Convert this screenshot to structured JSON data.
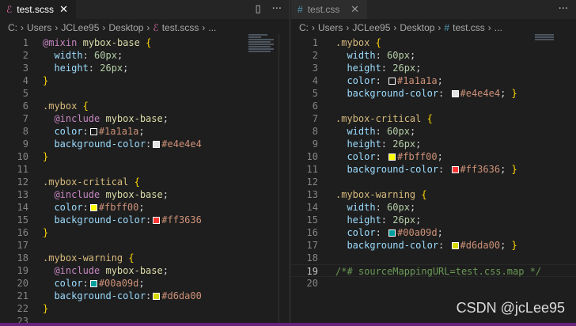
{
  "left": {
    "tab": {
      "label": "test.scss",
      "icon": "sass-icon",
      "close": "✕"
    },
    "breadcrumb": [
      "C:",
      "Users",
      "JCLee95",
      "Desktop",
      "test.scss",
      "..."
    ],
    "actions": {
      "split": "▯",
      "more": "···"
    },
    "current_line": 0,
    "lines": [
      [
        [
          "@mixin",
          "kw"
        ],
        [
          " ",
          "p"
        ],
        [
          "mybox-base",
          "name"
        ],
        [
          " ",
          "p"
        ],
        [
          "{",
          "brace"
        ]
      ],
      [
        [
          "  width",
          "prop"
        ],
        [
          ": ",
          "p"
        ],
        [
          "60px",
          "num"
        ],
        [
          ";",
          "p"
        ]
      ],
      [
        [
          "  height",
          "prop"
        ],
        [
          ": ",
          "p"
        ],
        [
          "26px",
          "num"
        ],
        [
          ";",
          "p"
        ]
      ],
      [
        [
          "}",
          "brace"
        ]
      ],
      [],
      [
        [
          ".mybox",
          "sel"
        ],
        [
          " ",
          "p"
        ],
        [
          "{",
          "brace"
        ]
      ],
      [
        [
          "  @include",
          "kw"
        ],
        [
          " ",
          "p"
        ],
        [
          "mybox-base",
          "name"
        ],
        [
          ";",
          "p"
        ]
      ],
      [
        [
          "  color",
          "prop"
        ],
        [
          ":",
          "p"
        ],
        [
          "#1a1a1a",
          "swatch"
        ],
        [
          "#1a1a1a",
          "str"
        ],
        [
          ";",
          "p"
        ]
      ],
      [
        [
          "  background-color",
          "prop"
        ],
        [
          ":",
          "p"
        ],
        [
          "#e4e4e4",
          "swatch"
        ],
        [
          "#e4e4e4",
          "str"
        ]
      ],
      [
        [
          "}",
          "brace"
        ]
      ],
      [],
      [
        [
          ".mybox-critical",
          "sel"
        ],
        [
          " ",
          "p"
        ],
        [
          "{",
          "brace"
        ]
      ],
      [
        [
          "  @include",
          "kw"
        ],
        [
          " ",
          "p"
        ],
        [
          "mybox-base",
          "name"
        ],
        [
          ";",
          "p"
        ]
      ],
      [
        [
          "  color",
          "prop"
        ],
        [
          ":",
          "p"
        ],
        [
          "#fbff00",
          "swatch"
        ],
        [
          "#fbff00",
          "str"
        ],
        [
          ";",
          "p"
        ]
      ],
      [
        [
          "  background-color",
          "prop"
        ],
        [
          ":",
          "p"
        ],
        [
          "#ff3636",
          "swatch"
        ],
        [
          "#ff3636",
          "str"
        ]
      ],
      [
        [
          "}",
          "brace"
        ]
      ],
      [],
      [
        [
          ".mybox-warning",
          "sel"
        ],
        [
          " ",
          "p"
        ],
        [
          "{",
          "brace"
        ]
      ],
      [
        [
          "  @include",
          "kw"
        ],
        [
          " ",
          "p"
        ],
        [
          "mybox-base",
          "name"
        ],
        [
          ";",
          "p"
        ]
      ],
      [
        [
          "  color",
          "prop"
        ],
        [
          ":",
          "p"
        ],
        [
          "#00a09d",
          "swatch"
        ],
        [
          "#00a09d",
          "str"
        ],
        [
          ";",
          "p"
        ]
      ],
      [
        [
          "  background-color",
          "prop"
        ],
        [
          ":",
          "p"
        ],
        [
          "#d6da00",
          "swatch"
        ],
        [
          "#d6da00",
          "str"
        ]
      ],
      [
        [
          "}",
          "brace"
        ]
      ],
      []
    ]
  },
  "right": {
    "tab": {
      "label": "test.css",
      "icon": "hash-icon",
      "close": "✕"
    },
    "breadcrumb": [
      "C:",
      "Users",
      "JCLee95",
      "Desktop",
      "test.css",
      "..."
    ],
    "actions": {
      "more": "···"
    },
    "current_line": 19,
    "lines": [
      [
        [
          ".mybox",
          "sel"
        ],
        [
          " ",
          "p"
        ],
        [
          "{",
          "brace"
        ]
      ],
      [
        [
          "  width",
          "prop"
        ],
        [
          ": ",
          "p"
        ],
        [
          "60px",
          "num"
        ],
        [
          ";",
          "p"
        ]
      ],
      [
        [
          "  height",
          "prop"
        ],
        [
          ": ",
          "p"
        ],
        [
          "26px",
          "num"
        ],
        [
          ";",
          "p"
        ]
      ],
      [
        [
          "  color",
          "prop"
        ],
        [
          ": ",
          "p"
        ],
        [
          "#1a1a1a",
          "swatch"
        ],
        [
          "#1a1a1a",
          "str"
        ],
        [
          ";",
          "p"
        ]
      ],
      [
        [
          "  background-color",
          "prop"
        ],
        [
          ": ",
          "p"
        ],
        [
          "#e4e4e4",
          "swatch"
        ],
        [
          "#e4e4e4",
          "str"
        ],
        [
          "; ",
          "p"
        ],
        [
          "}",
          "brace"
        ]
      ],
      [],
      [
        [
          ".mybox-critical",
          "sel"
        ],
        [
          " ",
          "p"
        ],
        [
          "{",
          "brace"
        ]
      ],
      [
        [
          "  width",
          "prop"
        ],
        [
          ": ",
          "p"
        ],
        [
          "60px",
          "num"
        ],
        [
          ";",
          "p"
        ]
      ],
      [
        [
          "  height",
          "prop"
        ],
        [
          ": ",
          "p"
        ],
        [
          "26px",
          "num"
        ],
        [
          ";",
          "p"
        ]
      ],
      [
        [
          "  color",
          "prop"
        ],
        [
          ": ",
          "p"
        ],
        [
          "#fbff00",
          "swatch"
        ],
        [
          "#fbff00",
          "str"
        ],
        [
          ";",
          "p"
        ]
      ],
      [
        [
          "  background-color",
          "prop"
        ],
        [
          ": ",
          "p"
        ],
        [
          "#ff3636",
          "swatch"
        ],
        [
          "#ff3636",
          "str"
        ],
        [
          "; ",
          "p"
        ],
        [
          "}",
          "brace"
        ]
      ],
      [],
      [
        [
          ".mybox-warning",
          "sel"
        ],
        [
          " ",
          "p"
        ],
        [
          "{",
          "brace"
        ]
      ],
      [
        [
          "  width",
          "prop"
        ],
        [
          ": ",
          "p"
        ],
        [
          "60px",
          "num"
        ],
        [
          ";",
          "p"
        ]
      ],
      [
        [
          "  height",
          "prop"
        ],
        [
          ": ",
          "p"
        ],
        [
          "26px",
          "num"
        ],
        [
          ";",
          "p"
        ]
      ],
      [
        [
          "  color",
          "prop"
        ],
        [
          ": ",
          "p"
        ],
        [
          "#00a09d",
          "swatch"
        ],
        [
          "#00a09d",
          "str"
        ],
        [
          ";",
          "p"
        ]
      ],
      [
        [
          "  background-color",
          "prop"
        ],
        [
          ": ",
          "p"
        ],
        [
          "#d6da00",
          "swatch"
        ],
        [
          "#d6da00",
          "str"
        ],
        [
          "; ",
          "p"
        ],
        [
          "}",
          "brace"
        ]
      ],
      [],
      [
        [
          "/*# sourceMappingURL=test.css.map */",
          "com"
        ]
      ],
      []
    ]
  },
  "watermark": "CSDN @jcLee95",
  "colors": {
    "status_bar": "#68217a",
    "background": "#1e1e1e"
  }
}
